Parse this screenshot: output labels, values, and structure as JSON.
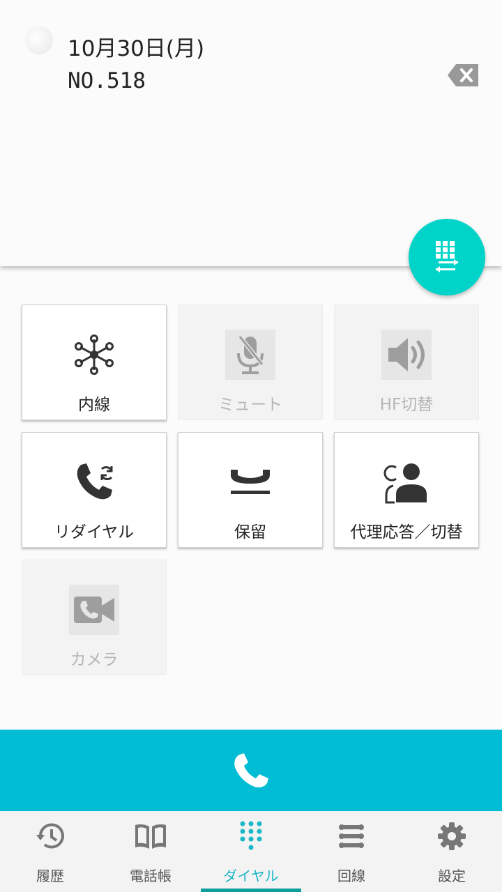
{
  "header": {
    "date": "10月30日(月)",
    "number": "NO.518"
  },
  "icons": {
    "backspace": "backspace-icon",
    "keypad_switch": "dialpad-switch-icon",
    "call": "phone-icon"
  },
  "functions": [
    {
      "label": "内線",
      "icon": "extension-network-icon",
      "enabled": true
    },
    {
      "label": "ミュート",
      "icon": "mic-off-icon",
      "enabled": false
    },
    {
      "label": "HF切替",
      "icon": "speaker-icon",
      "enabled": false
    },
    {
      "label": "リダイヤル",
      "icon": "redial-icon",
      "enabled": true
    },
    {
      "label": "保留",
      "icon": "hold-icon",
      "enabled": true
    },
    {
      "label": "代理応答／切替",
      "icon": "pickup-icon",
      "enabled": true
    },
    {
      "label": "カメラ",
      "icon": "video-call-icon",
      "enabled": false
    }
  ],
  "nav": {
    "items": [
      {
        "label": "履歴",
        "icon": "history-icon"
      },
      {
        "label": "電話帳",
        "icon": "book-icon"
      },
      {
        "label": "ダイヤル",
        "icon": "dialpad-icon"
      },
      {
        "label": "回線",
        "icon": "lines-icon"
      },
      {
        "label": "設定",
        "icon": "gear-icon"
      }
    ],
    "active_index": 2
  },
  "colors": {
    "accent": "#00bcd4",
    "fab": "#00d4c8",
    "active_nav": "#19b8c8",
    "indicator": "#0f9e9e"
  }
}
